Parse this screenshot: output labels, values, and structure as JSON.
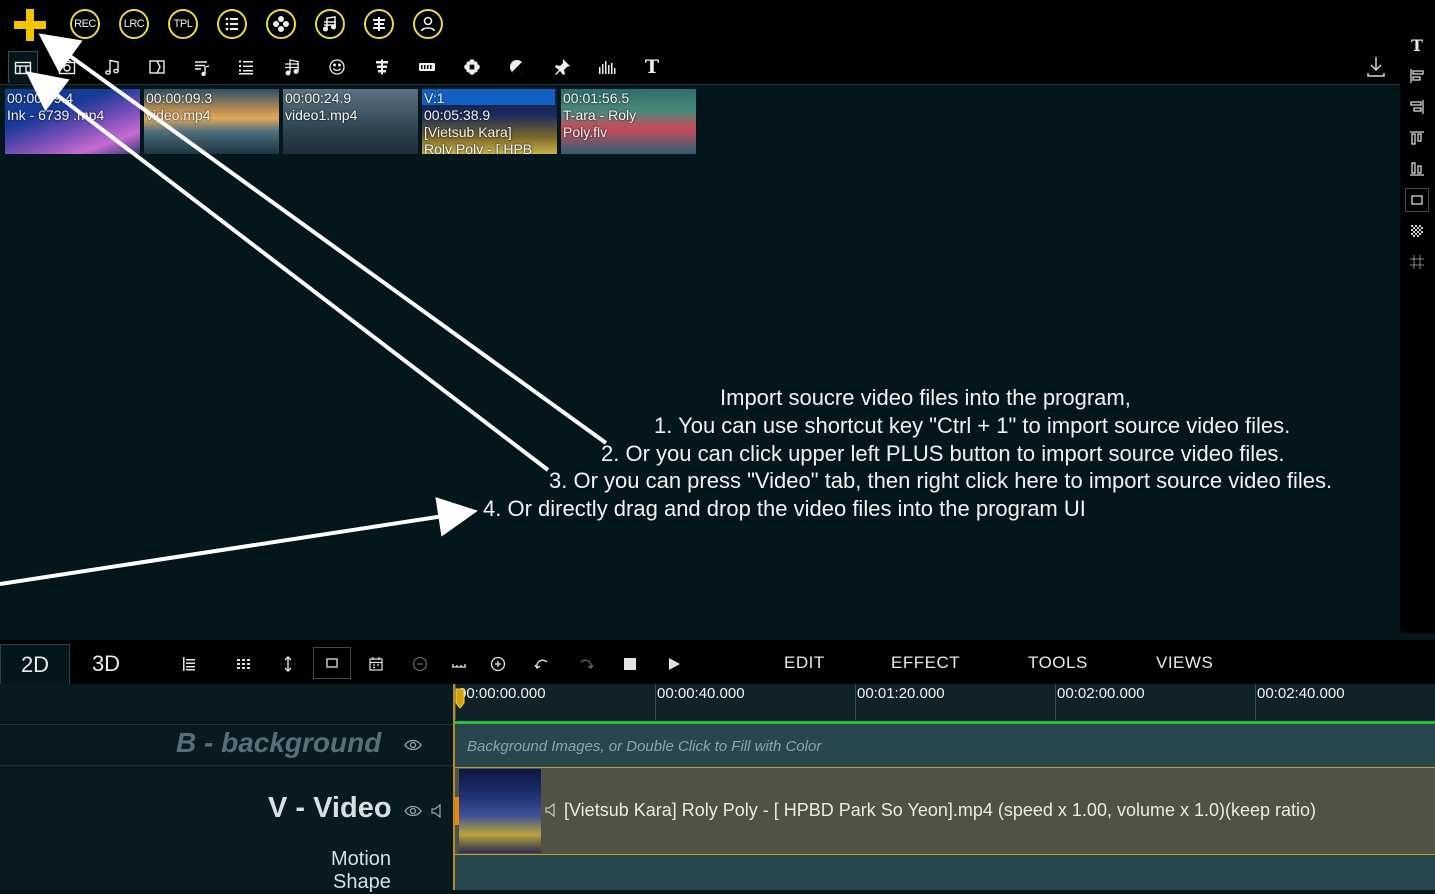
{
  "toolbar": {
    "rec_label": "REC",
    "lrc_label": "LRC",
    "tpl_label": "TPL"
  },
  "tabs": {
    "text_tab_label": "T"
  },
  "media": {
    "items": [
      {
        "time": "00:00:09.4",
        "name": "Ink - 6739 .mp4"
      },
      {
        "time": "00:00:09.3",
        "name": "video.mp4"
      },
      {
        "time": "00:00:24.9",
        "name": "video1.mp4"
      },
      {
        "badge": "V:1",
        "time": "00:05:38.9",
        "name": "[Vietsub Kara]",
        "name2": "Roly Poly - [ HPB"
      },
      {
        "time": "00:01:56.5",
        "name": "T-ara - Roly",
        "name2": "Poly.flv"
      }
    ]
  },
  "instructions": {
    "line0": "Import soucre video files into the program,",
    "line1": "1. You can use shortcut key \"Ctrl + 1\" to import source video files.",
    "line2": "2. Or you can click upper left PLUS button to import source video files.",
    "line3": "3. Or you can press \"Video\" tab, then right click here to import source video files.",
    "line4": "4. Or directly drag and drop the video files into the program UI"
  },
  "rightbar": {
    "text_icon_label": "T"
  },
  "modes": {
    "mode_2d": "2D",
    "mode_3d": "3D"
  },
  "menu": {
    "edit": "EDIT",
    "effect": "EFFECT",
    "tools": "TOOLS",
    "views": "VIEWS"
  },
  "timeline": {
    "ticks": [
      "00:00:00.000",
      "00:00:40.000",
      "00:01:20.000",
      "00:02:00.000",
      "00:02:40.000"
    ],
    "background_track": {
      "label": "B - background",
      "hint": "Background Images, or Double Click to Fill with Color"
    },
    "video_track": {
      "label": "V - Video",
      "clip_text": "[Vietsub Kara] Roly Poly - [ HPBD Park So Yeon].mp4  (speed x 1.00, volume x 1.0)(keep ratio)",
      "sub_label_1": "Motion",
      "sub_label_2": "Shape"
    }
  },
  "colors": {
    "accent_yellow": "#f2c400",
    "background": "#02161c",
    "timeline_green": "#24c03a",
    "clip_border": "#c79a30"
  }
}
